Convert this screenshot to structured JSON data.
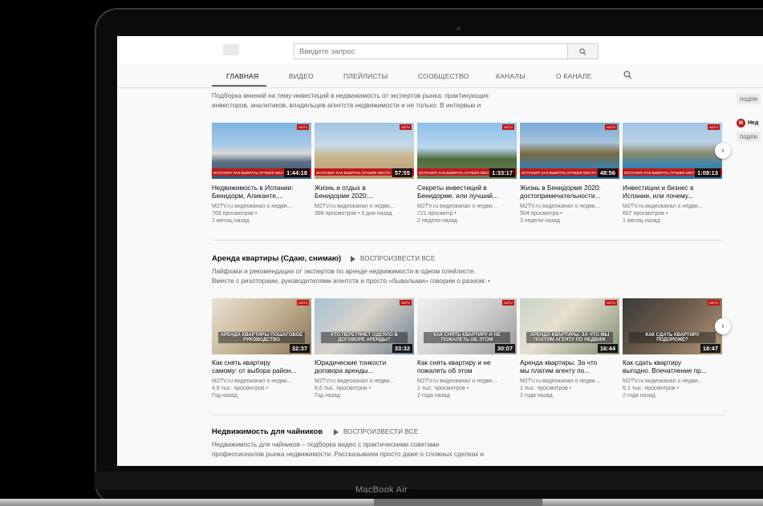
{
  "device": {
    "brand": "MacBook Air"
  },
  "search": {
    "placeholder": "Введите запрос"
  },
  "tabs": [
    "ГЛАВНАЯ",
    "ВИДЕО",
    "ПЛЕЙЛИСТЫ",
    "СООБЩЕСТВО",
    "КАНАЛЫ",
    "О КАНАЛЕ"
  ],
  "section1": {
    "desc": [
      "Подборка мнений на тему инвестиций в недвижимость от экспертов рынка: практикующих",
      "инвесторов, аналитиков, владельцев агентств недвижимости и не только. В интервью и"
    ],
    "videos": [
      {
        "title1": "Недвижимость в Испании:",
        "title2": "Бенидорм, Аликанте,...",
        "channel": "M2TV.ru видеоканал о недви...",
        "views": "769 просмотров •",
        "age": "1 месяц назад",
        "duration": "1:44:18",
        "ribbon": "ИСПАНИЯ: КАК ВЫБРАТЬ ЛУЧШЕЕ МЕСТО"
      },
      {
        "title1": "Жизнь и отдых в",
        "title2": "Бенидорме 2020:...",
        "channel": "M2TV.ru видеоканал о недви...",
        "views": "388 просмотров • 3 дня назад",
        "age": "",
        "duration": "57:55",
        "ribbon": "ИСПАНИЯ: КАК ВЫБРАТЬ ЛУЧШЕЕ МЕСТО"
      },
      {
        "title1": "Секреты инвестиций в",
        "title2": "Бенидорме, или лучший...",
        "channel": "M2TV.ru видеоканал о недви...",
        "views": "721 просмотр •",
        "age": "2 недели назад",
        "duration": "1:33:17",
        "ribbon": "ИСПАНИЯ: КАК ВЫБРАТЬ ЛУЧШЕЕ МЕСТО"
      },
      {
        "title1": "Жизнь в Бенидорме 2020:",
        "title2": "достопримечательности...",
        "channel": "M2TV.ru видеоканал о недви...",
        "views": "504 просмотра •",
        "age": "3 недели назад",
        "duration": "48:56",
        "ribbon": "ИСПАНИЯ: КАК ВЫБРАТЬ ЛУЧШЕЕ МЕСТО"
      },
      {
        "title1": "Инвестиции и бизнес в",
        "title2": "Испании, или почему...",
        "channel": "M2TV.ru видеоканал о недви...",
        "views": "607 просмотров •",
        "age": "1 месяц назад",
        "duration": "1:08:13",
        "ribbon": "ИСПАНИЯ: КАК ВЫБРАТЬ ЛУЧШЕЕ МЕСТО"
      }
    ]
  },
  "section2": {
    "title": "Аренда квартиры (Сдаю, снимаю)",
    "play_all": "ВОСПРОИЗВЕСТИ ВСЕ",
    "desc": [
      "Лайфхаки и рекомендации от экспертов по аренде недвижимости в одном плейлисте.",
      "Вместе с риэлторами, руководителями агентств и просто «бывалыми» говорим о разном: •"
    ],
    "videos": [
      {
        "title1": "Как снять квартиру",
        "title2": "самому: от выбора район...",
        "channel": "M2TV.ru видеоканал о недви...",
        "views": "4,9 тыс. просмотров •",
        "age": "Год назад",
        "duration": "32:37",
        "caption": "АРЕНДА КВАРТИРЫ ПОШАГОВОЕ РУКОВОДСТВО"
      },
      {
        "title1": "Юридические тонкости",
        "title2": "договора аренды...",
        "channel": "M2TV.ru видеоканал о недви...",
        "views": "8,6 тыс. просмотров •",
        "age": "Год назад",
        "duration": "33:32",
        "caption": "КТО ПЕРЕТЯНЕТ ОДЕЯЛО В ДОГОВОРЕ АРЕНДЫ?"
      },
      {
        "title1": "Как снять квартиру и не",
        "title2": "пожалеть об этом",
        "channel": "M2TV.ru видеоканал о недви...",
        "views": "1 тыс. просмотров •",
        "age": "2 года назад",
        "duration": "30:07",
        "caption": "КАК СНЯТЬ КВАРТИРУ И НЕ ПОЖАЛЕТЬ ОБ ЭТОМ"
      },
      {
        "title1": "Аренда квартиры. За что",
        "title2": "мы платим агенту по...",
        "channel": "M2TV.ru видеоканал о недви...",
        "views": "1 тыс. просмотров •",
        "age": "2 года назад",
        "duration": "16:44",
        "caption": "АРЕНДА КВАРТИРЫ. ЗА ЧТО МЫ ПЛАТИМ АГЕНТУ ПО НЕДВИЖ"
      },
      {
        "title1": "Как сдать квартиру",
        "title2": "выгодно. Впечатление пр...",
        "channel": "M2TV.ru видеоканал о недви...",
        "views": "6,1 тыс. просмотров •",
        "age": "2 года назад",
        "duration": "18:47",
        "caption": "КАК СДАТЬ КВАРТИРУ ПОДОРОЖЕ?"
      }
    ]
  },
  "section3": {
    "title": "Недвижимость для чайников",
    "play_all": "ВОСПРОИЗВЕСТИ ВСЕ",
    "desc": [
      "Недвижимость для чайников – подборка видео с практическими советами",
      "профессионалов рынка недвижимости. Рассказываем просто даже о сложных сделках и"
    ]
  },
  "sidebar": {
    "subscribe1": "подпи",
    "channel_short": "Нед",
    "subscribe2": "подпи",
    "avatar_text": "M"
  }
}
